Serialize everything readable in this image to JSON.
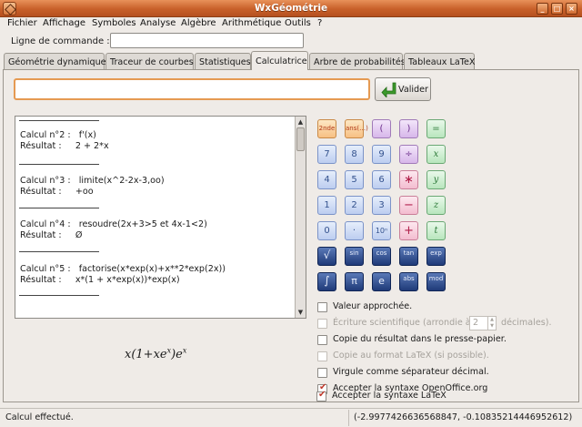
{
  "window": {
    "title": "WxGéométrie"
  },
  "menu": [
    "Fichier",
    "Affichage",
    "Symboles",
    "Analyse",
    "Algèbre",
    "Arithmétique",
    "Outils",
    "?"
  ],
  "command": {
    "label": "Ligne de commande :",
    "value": ""
  },
  "tabs": [
    "Géométrie dynamique",
    "Traceur de courbes",
    "Statistiques",
    "Calculatrice",
    "Arbre de probabilités",
    "Tableaux LaTeX"
  ],
  "active_tab": "Calculatrice",
  "calculator": {
    "input_value": "",
    "validate_label": "Valider",
    "results": [
      {
        "calc": "Calcul n°2 :   f'(x)",
        "result": "Résultat :     2 + 2*x"
      },
      {
        "calc": "Calcul n°3 :   limite(x^2-2x-3,oo)",
        "result": "Résultat :     +oo"
      },
      {
        "calc": "Calcul n°4 :   resoudre(2x+3>5 et 4x-1<2)",
        "result": "Résultat :     Ø"
      },
      {
        "calc": "Calcul n°5 :   factorise(x*exp(x)+x**2*exp(2x))",
        "result": "Résultat :     x*(1 + x*exp(x))*exp(x)"
      }
    ],
    "formula_display": "x(1+xeˣ)eˣ",
    "keys": {
      "row1": [
        "2nde",
        "ans(…)",
        "(",
        ")",
        "="
      ],
      "row2": [
        "7",
        "8",
        "9",
        "÷",
        "x"
      ],
      "row3": [
        "4",
        "5",
        "6",
        "∗",
        "y"
      ],
      "row4": [
        "1",
        "2",
        "3",
        "−",
        "z"
      ],
      "row5": [
        "0",
        "·",
        "10ⁿ",
        "+",
        "t"
      ],
      "row6": [
        "√",
        "sin",
        "cos",
        "tan",
        "exp"
      ],
      "row7": [
        "∫",
        "π",
        "e",
        "abs",
        "mod"
      ]
    },
    "options": [
      {
        "label": "Valeur approchée.",
        "checked": false,
        "disabled": false
      },
      {
        "label": "Écriture scientifique (arrondie à",
        "suffix": "décimales).",
        "spin_value": "2",
        "checked": false,
        "disabled": true
      },
      {
        "label": "Copie du résultat dans le presse-papier.",
        "checked": false,
        "disabled": false
      },
      {
        "label": "Copie au format LaTeX (si possible).",
        "checked": false,
        "disabled": true
      },
      {
        "label": "Virgule comme séparateur décimal.",
        "checked": false,
        "disabled": false
      },
      {
        "label": "Accepter la syntaxe OpenOffice.org",
        "checked": true,
        "disabled": false
      },
      {
        "label": "Accepter la syntaxe LaTeX",
        "checked": true,
        "disabled": false
      }
    ]
  },
  "status": {
    "left": "Calcul effectué.",
    "coords": "(-2.9977426636568847, -0.10835214446952612)"
  },
  "colors": {
    "titlebar": "#c8602a",
    "input_focus": "#e59a52",
    "check": "#c0392b"
  }
}
